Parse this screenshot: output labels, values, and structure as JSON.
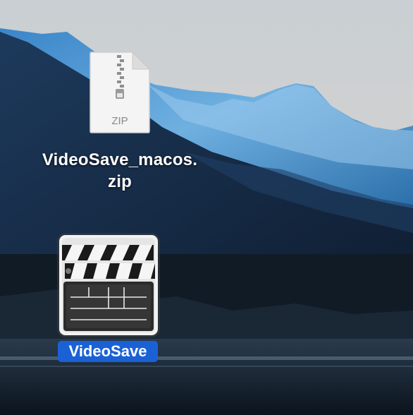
{
  "desktop": {
    "files": [
      {
        "name_line1": "VideoSave_macos.",
        "name_line2": "zip",
        "type_badge": "ZIP",
        "icon": "zip-archive-icon",
        "selected": false
      },
      {
        "name": "VideoSave",
        "icon": "clapperboard-app-icon",
        "selected": true
      }
    ]
  },
  "colors": {
    "selection": "#1a61d6",
    "label_text": "#ffffff"
  }
}
